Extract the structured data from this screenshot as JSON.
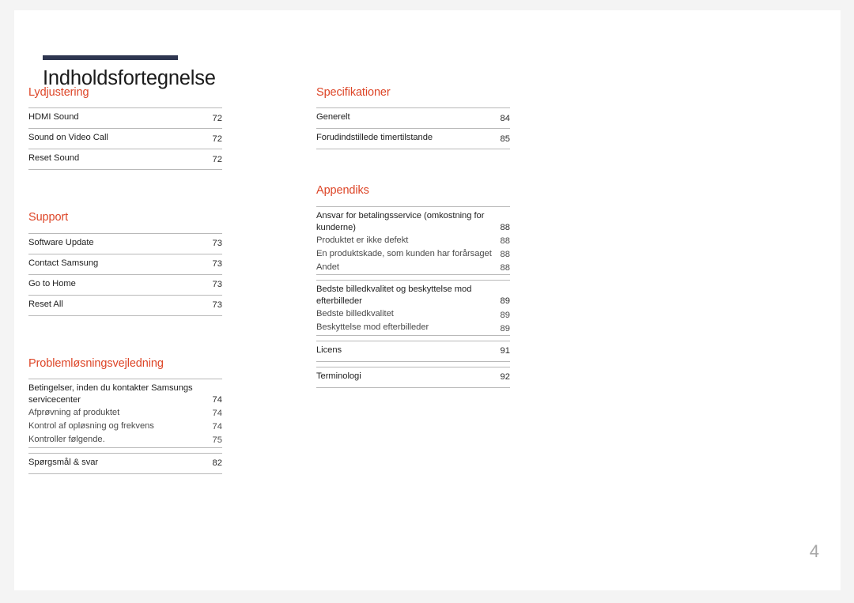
{
  "document": {
    "title": "Indholdsfortegnelse",
    "page_number": "4",
    "accent_color": "#dd4527",
    "rule_color": "#2e3650"
  },
  "left_column": {
    "sections": [
      {
        "heading": "Lydjustering",
        "groups": [
          {
            "entries": [
              {
                "label": "HDMI Sound",
                "page": "72",
                "level": 1
              },
              {
                "label": "Sound on Video Call",
                "page": "72",
                "level": 1
              },
              {
                "label": "Reset Sound",
                "page": "72",
                "level": 1
              }
            ]
          }
        ]
      },
      {
        "heading": "Support",
        "groups": [
          {
            "entries": [
              {
                "label": "Software Update",
                "page": "73",
                "level": 1
              },
              {
                "label": "Contact Samsung",
                "page": "73",
                "level": 1
              },
              {
                "label": "Go to Home",
                "page": "73",
                "level": 1
              },
              {
                "label": "Reset All",
                "page": "73",
                "level": 1
              }
            ]
          }
        ]
      },
      {
        "heading": "Problemløsningsvejledning",
        "groups": [
          {
            "entries": [
              {
                "label": "Betingelser, inden du kontakter Samsungs servicecenter",
                "page": "74",
                "level": 1,
                "no_rule": true
              },
              {
                "label": "Afprøvning af produktet",
                "page": "74",
                "level": 2
              },
              {
                "label": "Kontrol af opløsning og frekvens",
                "page": "74",
                "level": 2
              },
              {
                "label": "Kontroller følgende.",
                "page": "75",
                "level": 2
              }
            ],
            "closed": true
          },
          {
            "entries": [
              {
                "label": "Spørgsmål & svar",
                "page": "82",
                "level": 1
              }
            ]
          }
        ]
      }
    ]
  },
  "right_column": {
    "sections": [
      {
        "heading": "Specifikationer",
        "groups": [
          {
            "entries": [
              {
                "label": "Generelt",
                "page": "84",
                "level": 1
              },
              {
                "label": "Forudindstillede timertilstande",
                "page": "85",
                "level": 1
              }
            ]
          }
        ]
      },
      {
        "heading": "Appendiks",
        "groups": [
          {
            "entries": [
              {
                "label": "Ansvar for betalingsservice (omkostning for kunderne)",
                "page": "88",
                "level": 1,
                "no_rule": true
              },
              {
                "label": "Produktet er ikke defekt",
                "page": "88",
                "level": 2
              },
              {
                "label": "En produktskade, som kunden har forårsaget",
                "page": "88",
                "level": 2
              },
              {
                "label": "Andet",
                "page": "88",
                "level": 2
              }
            ],
            "closed": true
          },
          {
            "entries": [
              {
                "label": "Bedste billedkvalitet og beskyttelse mod efterbilleder",
                "page": "89",
                "level": 1,
                "no_rule": true
              },
              {
                "label": "Bedste billedkvalitet",
                "page": "89",
                "level": 2
              },
              {
                "label": "Beskyttelse mod efterbilleder",
                "page": "89",
                "level": 2
              }
            ],
            "closed": true
          },
          {
            "entries": [
              {
                "label": "Licens",
                "page": "91",
                "level": 1
              }
            ]
          },
          {
            "entries": [
              {
                "label": "Terminologi",
                "page": "92",
                "level": 1
              }
            ]
          }
        ]
      }
    ]
  }
}
